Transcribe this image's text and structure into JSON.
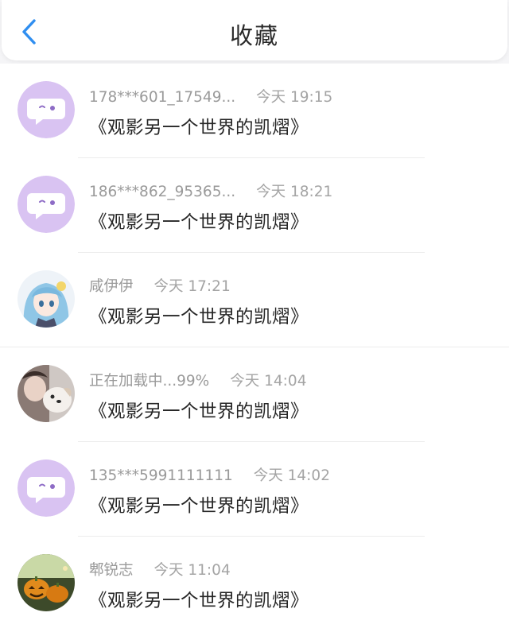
{
  "header": {
    "title": "收藏",
    "back_icon": "chevron-left-icon",
    "accent_color": "#2f8ef0"
  },
  "favorites": [
    {
      "username": "178***601_17549...",
      "time": "今天 19:15",
      "content": "《观影另一个世界的凯熠》",
      "avatar": "default-chat-avatar"
    },
    {
      "username": "186***862_95365...",
      "time": "今天 18:21",
      "content": "《观影另一个世界的凯熠》",
      "avatar": "default-chat-avatar"
    },
    {
      "username": "咸伊伊",
      "time": "今天 17:21",
      "content": "《观影另一个世界的凯熠》",
      "avatar": "anime-girl-avatar"
    },
    {
      "username": "正在加载中...99%",
      "time": "今天 14:04",
      "content": "《观影另一个世界的凯熠》",
      "avatar": "photo-dog-avatar"
    },
    {
      "username": "135***5991111111",
      "time": "今天 14:02",
      "content": "《观影另一个世界的凯熠》",
      "avatar": "default-chat-avatar"
    },
    {
      "username": "郫锐志",
      "time": "今天 11:04",
      "content": "《观影另一个世界的凯熠》",
      "avatar": "pumpkin-avatar"
    }
  ]
}
